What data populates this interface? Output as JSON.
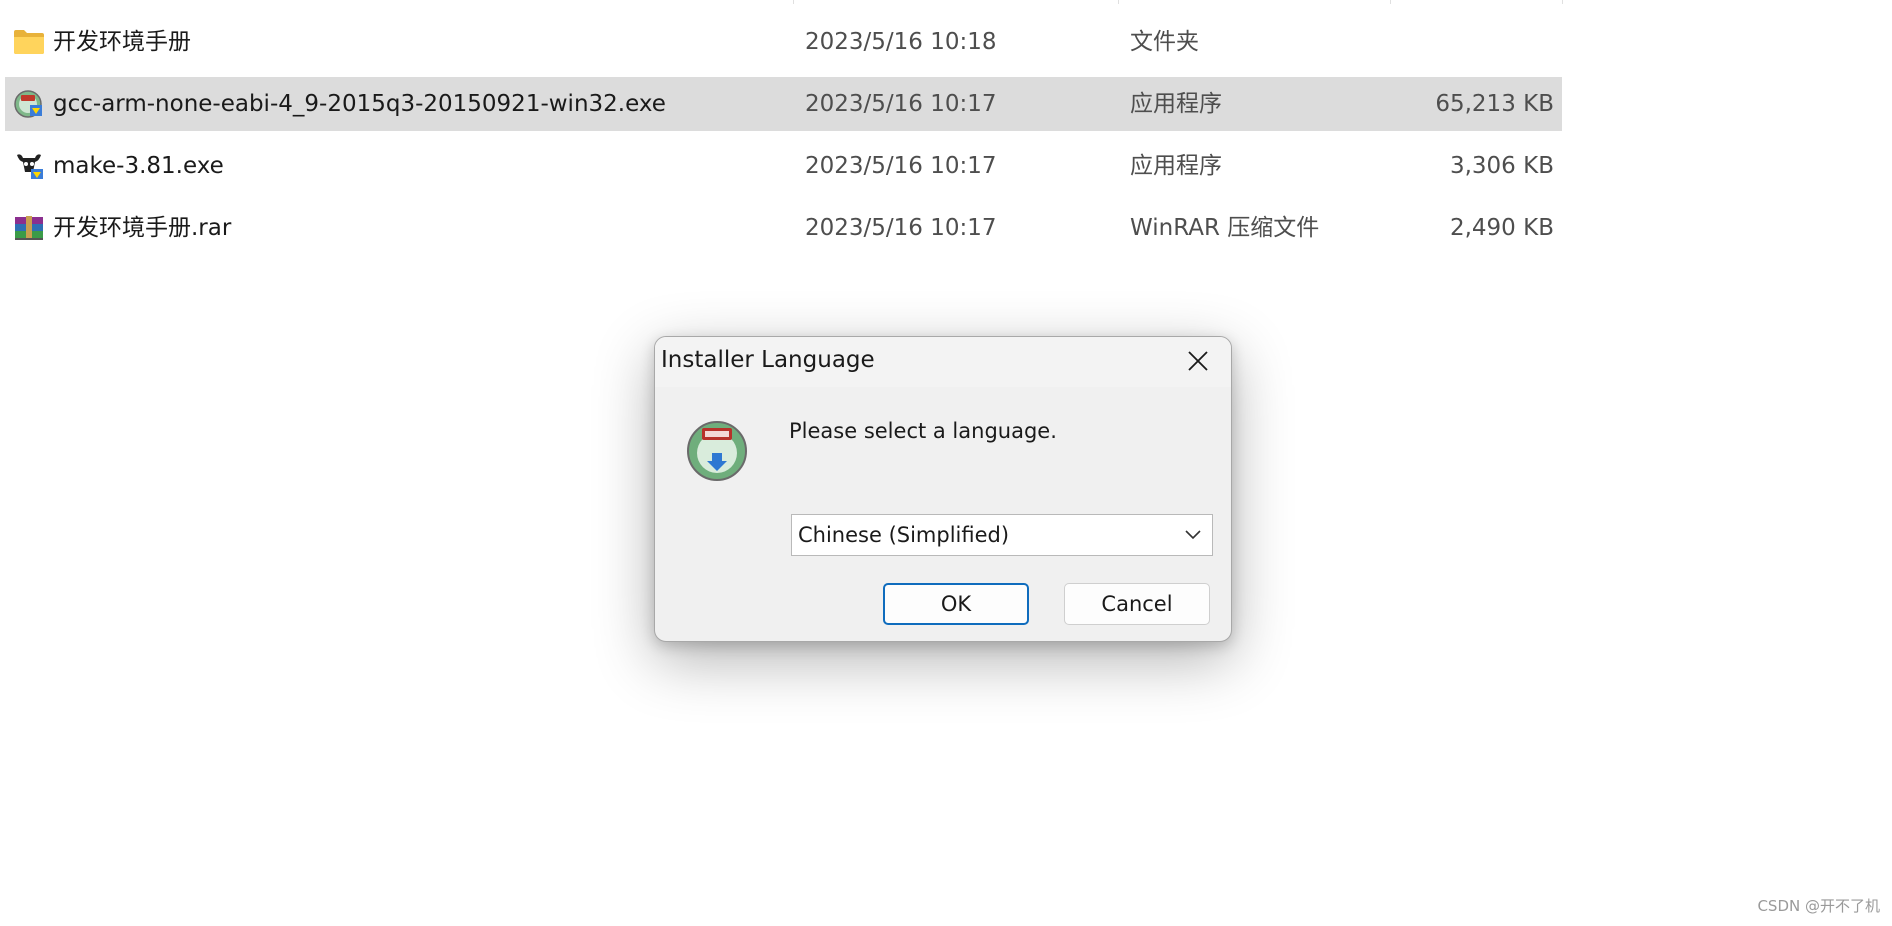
{
  "files": [
    {
      "name": "开发环境手册",
      "date": "2023/5/16 10:18",
      "type": "文件夹",
      "size": "",
      "icon": "folder-icon",
      "selected": false
    },
    {
      "name": "gcc-arm-none-eabi-4_9-2015q3-20150921-win32.exe",
      "date": "2023/5/16 10:17",
      "type": "应用程序",
      "size": "65,213 KB",
      "icon": "installer-icon",
      "selected": true
    },
    {
      "name": "make-3.81.exe",
      "date": "2023/5/16 10:17",
      "type": "应用程序",
      "size": "3,306 KB",
      "icon": "gnu-icon",
      "selected": false
    },
    {
      "name": "开发环境手册.rar",
      "date": "2023/5/16 10:17",
      "type": "WinRAR 压缩文件",
      "size": "2,490 KB",
      "icon": "winrar-icon",
      "selected": false
    }
  ],
  "dialog": {
    "title": "Installer Language",
    "prompt": "Please select a language.",
    "selected_language": "Chinese (Simplified)",
    "ok_label": "OK",
    "cancel_label": "Cancel",
    "icons": {
      "logo": "nsis-icon",
      "close": "close-icon",
      "dropdown": "chevron-down-icon"
    }
  },
  "watermark": "CSDN @开不了机",
  "colors": {
    "selection": "#dcdcdc",
    "accent": "#0f6cbd",
    "dialog_bg": "#f0f0f0"
  }
}
